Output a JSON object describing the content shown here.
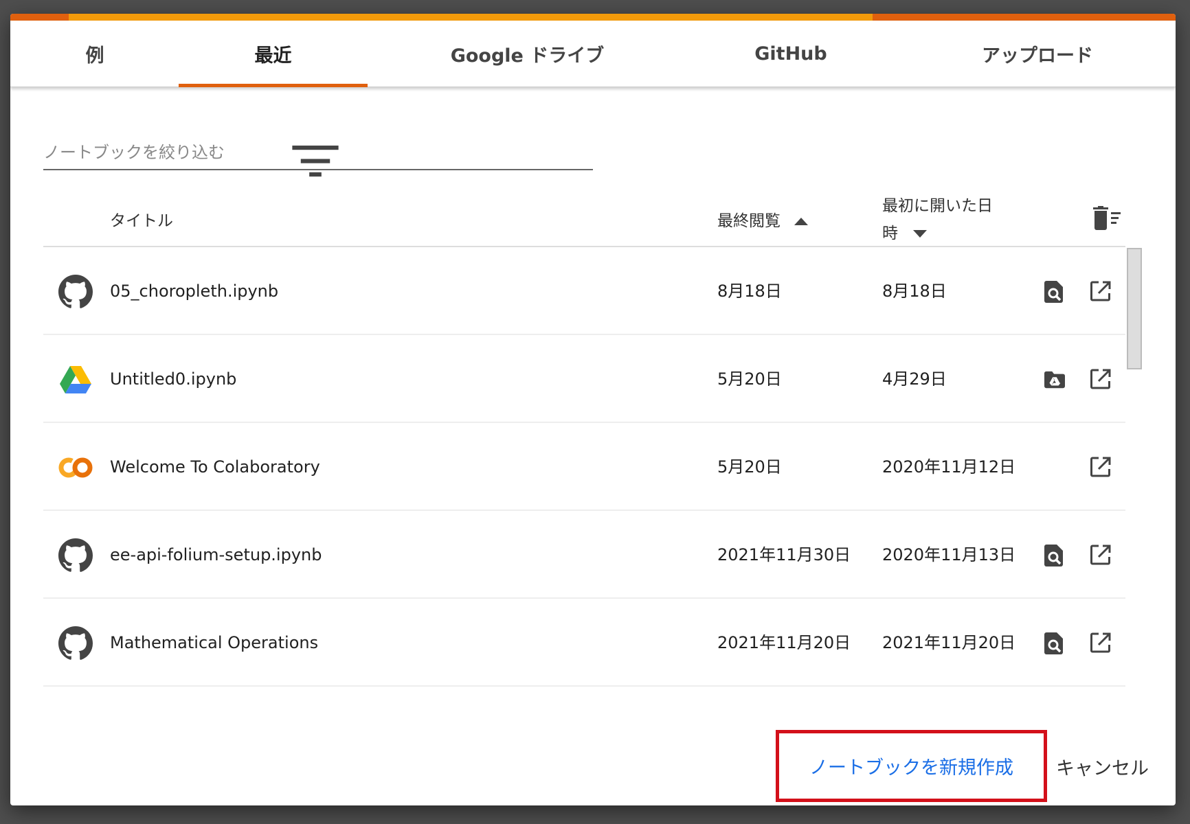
{
  "tabs": [
    {
      "label": "例"
    },
    {
      "label": "最近",
      "active": true
    },
    {
      "label": "Google ドライブ"
    },
    {
      "label": "GitHub"
    },
    {
      "label": "アップロード"
    }
  ],
  "filter": {
    "placeholder": "ノートブックを絞り込む",
    "value": ""
  },
  "table": {
    "headers": {
      "title": "タイトル",
      "last_viewed": "最終閲覧",
      "last_viewed_sort": "ascending",
      "first_opened_line1": "最初に開いた日",
      "first_opened_line2": "時",
      "first_opened_sort": "descending"
    },
    "rows": [
      {
        "source": "github",
        "title": "05_choropleth.ipynb",
        "last_viewed": "8月18日",
        "first_opened": "8月18日",
        "actions": [
          "preview-icon",
          "open-in-new-tab-icon"
        ]
      },
      {
        "source": "google-drive",
        "title": "Untitled0.ipynb",
        "last_viewed": "5月20日",
        "first_opened": "4月29日",
        "actions": [
          "drive-folder-icon",
          "open-in-new-tab-icon"
        ]
      },
      {
        "source": "colab",
        "title": "Welcome To Colaboratory",
        "last_viewed": "5月20日",
        "first_opened": "2020年11月12日",
        "actions": [
          "open-in-new-tab-icon"
        ]
      },
      {
        "source": "github",
        "title": "ee-api-folium-setup.ipynb",
        "last_viewed": "2021年11月30日",
        "first_opened": "2020年11月13日",
        "actions": [
          "preview-icon",
          "open-in-new-tab-icon"
        ]
      },
      {
        "source": "github",
        "title": "Mathematical Operations",
        "last_viewed": "2021年11月20日",
        "first_opened": "2021年11月20日",
        "actions": [
          "preview-icon",
          "open-in-new-tab-icon"
        ]
      }
    ]
  },
  "buttons": {
    "new_notebook": "ノートブックを新規作成",
    "cancel": "キャンセル"
  },
  "colors": {
    "accent": "#e0600e",
    "topbar": "#f29a0a",
    "link": "#1a6ee6",
    "highlight_box": "#d3101a"
  }
}
